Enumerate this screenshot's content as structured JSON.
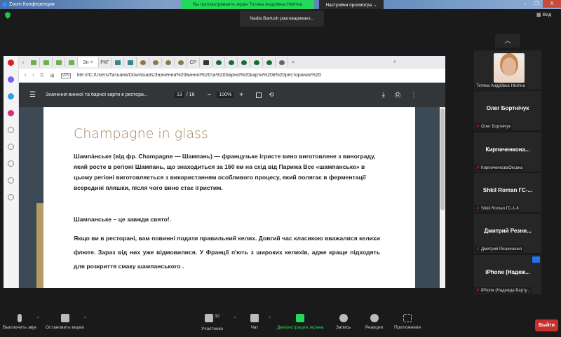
{
  "window": {
    "title": "Zoom Конференция",
    "banner": "Вы просматриваете экран Тетяна Андріївна Нікітіна",
    "view_options": "Настройки просмотра ⌄",
    "notification": "Nadia Bartush разговаривает...",
    "view_label": "Вид",
    "min": "–",
    "max": "❐",
    "close": "X"
  },
  "browser": {
    "active_tab": "Зн",
    "tab_close": "×",
    "tab_labels": [
      "РКГ",
      "СР"
    ],
    "url": "file:///C:/Users/Татьяна/Downloads/Значення%20винної%20та%20барної%20карти%20в%20ресторанах%20",
    "vpn": "VPN",
    "nav": {
      "back": "‹",
      "forward": "›",
      "reload": "C",
      "grid": "⊞",
      "newtab": "+",
      "search": "⌕"
    }
  },
  "pdf": {
    "title": "Значення винної та барної карти в рестора...",
    "page": "13",
    "total": "/ 16",
    "zoom": "100%",
    "minus": "−",
    "plus": "+",
    "menu": "☰",
    "download": "⤓",
    "print": "⎙",
    "more": "⋮"
  },
  "document": {
    "heading": "Champagne in glass",
    "p1": "Шампа́нське (від фр. Champagne — Шампань) — французьке ігристе вино виготовлене з винограду, який росте в регіоні Шампань, що знаходиться за 160 км на схід від Парижа Все «шампанське» в цьому регіоні виготовляється з використанням особливого процесу, який полягає в ферментації всередині пляшки, після чого вино стає ігристим.",
    "p2": "Шампанське – це завжди свято!.",
    "p3": "Якщо ви в ресторані, вам повинні подати правильний келих. Довгий час класикою вважалися келихи флюте. Зараз від них уже відмовилися. У Франції п'ють з широких келихів, адже краще підходять для розкриття смаку шампанського ."
  },
  "participants": [
    {
      "name": "",
      "label": "Тетяна Андріївна Нікітіна",
      "muted": false
    },
    {
      "name": "Олег Бортнічук",
      "label": "Олег Бортнічук",
      "muted": true
    },
    {
      "name": "Кирпиченкона...",
      "label": "КирпиченковаОксана",
      "muted": true
    },
    {
      "name": "Shkil Roman ГС-...",
      "label": "Shkil Roman ГС-1-8",
      "muted": true
    },
    {
      "name": "Дмитрий Резни...",
      "label": "Дмитрий Резниченко",
      "muted": true
    },
    {
      "name": "iPhone (Надеж...",
      "label": "iPhone (Надежда Барту...",
      "muted": true
    }
  ],
  "more_button": "···",
  "toolbar": {
    "mute": "Выключить звук",
    "video": "Остановить видео",
    "participants": "Участники",
    "participants_count": "32",
    "chat": "Чат",
    "share": "Демонстрация экрана",
    "record": "Запись",
    "reactions": "Реакции",
    "apps": "Приложения",
    "leave": "Выйти",
    "caret": "^"
  },
  "colors": {
    "share_green": "#23d959",
    "leave_red": "#c8302e",
    "heading": "#a88462"
  }
}
